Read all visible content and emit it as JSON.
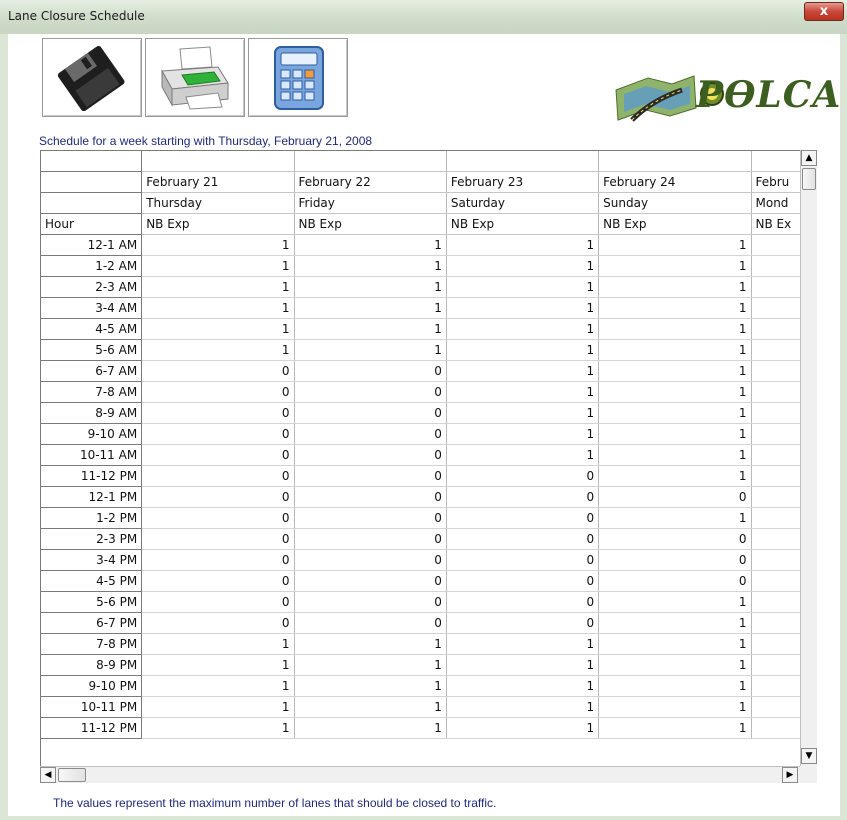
{
  "window": {
    "title": "Lane Closure Schedule",
    "close_glyph": "x"
  },
  "toolbar": [
    {
      "name": "save-button",
      "icon": "floppy-disk-icon"
    },
    {
      "name": "print-button",
      "icon": "printer-icon"
    },
    {
      "name": "calculator-button",
      "icon": "calculator-icon"
    }
  ],
  "logo": {
    "text": "PƟLCA"
  },
  "schedule": {
    "caption": "Schedule for a week starting with Thursday, February 21, 2008",
    "hour_header": "Hour",
    "columns": [
      {
        "date": "February 21",
        "day": "Thursday",
        "direction": "NB Exp"
      },
      {
        "date": "February 22",
        "day": "Friday",
        "direction": "NB Exp"
      },
      {
        "date": "February 23",
        "day": "Saturday",
        "direction": "NB Exp"
      },
      {
        "date": "February 24",
        "day": "Sunday",
        "direction": "NB Exp"
      },
      {
        "date": "Febru",
        "day": "Mond",
        "direction": "NB Ex"
      }
    ],
    "rows": [
      {
        "hour": "12-1 AM",
        "values": [
          "1",
          "1",
          "1",
          "1",
          ""
        ]
      },
      {
        "hour": "1-2 AM",
        "values": [
          "1",
          "1",
          "1",
          "1",
          ""
        ]
      },
      {
        "hour": "2-3 AM",
        "values": [
          "1",
          "1",
          "1",
          "1",
          ""
        ]
      },
      {
        "hour": "3-4 AM",
        "values": [
          "1",
          "1",
          "1",
          "1",
          ""
        ]
      },
      {
        "hour": "4-5 AM",
        "values": [
          "1",
          "1",
          "1",
          "1",
          ""
        ]
      },
      {
        "hour": "5-6 AM",
        "values": [
          "1",
          "1",
          "1",
          "1",
          ""
        ]
      },
      {
        "hour": "6-7 AM",
        "values": [
          "0",
          "0",
          "1",
          "1",
          ""
        ]
      },
      {
        "hour": "7-8 AM",
        "values": [
          "0",
          "0",
          "1",
          "1",
          ""
        ]
      },
      {
        "hour": "8-9 AM",
        "values": [
          "0",
          "0",
          "1",
          "1",
          ""
        ]
      },
      {
        "hour": "9-10 AM",
        "values": [
          "0",
          "0",
          "1",
          "1",
          ""
        ]
      },
      {
        "hour": "10-11 AM",
        "values": [
          "0",
          "0",
          "1",
          "1",
          ""
        ]
      },
      {
        "hour": "11-12 PM",
        "values": [
          "0",
          "0",
          "0",
          "1",
          ""
        ]
      },
      {
        "hour": "12-1 PM",
        "values": [
          "0",
          "0",
          "0",
          "0",
          ""
        ]
      },
      {
        "hour": "1-2 PM",
        "values": [
          "0",
          "0",
          "0",
          "1",
          ""
        ]
      },
      {
        "hour": "2-3 PM",
        "values": [
          "0",
          "0",
          "0",
          "0",
          ""
        ]
      },
      {
        "hour": "3-4 PM",
        "values": [
          "0",
          "0",
          "0",
          "0",
          ""
        ]
      },
      {
        "hour": "4-5 PM",
        "values": [
          "0",
          "0",
          "0",
          "0",
          ""
        ]
      },
      {
        "hour": "5-6 PM",
        "values": [
          "0",
          "0",
          "0",
          "1",
          ""
        ]
      },
      {
        "hour": "6-7 PM",
        "values": [
          "0",
          "0",
          "0",
          "1",
          ""
        ]
      },
      {
        "hour": "7-8 PM",
        "values": [
          "1",
          "1",
          "1",
          "1",
          ""
        ]
      },
      {
        "hour": "8-9 PM",
        "values": [
          "1",
          "1",
          "1",
          "1",
          ""
        ]
      },
      {
        "hour": "9-10 PM",
        "values": [
          "1",
          "1",
          "1",
          "1",
          ""
        ]
      },
      {
        "hour": "10-11 PM",
        "values": [
          "1",
          "1",
          "1",
          "1",
          ""
        ]
      },
      {
        "hour": "11-12 PM",
        "values": [
          "1",
          "1",
          "1",
          "1",
          ""
        ]
      }
    ],
    "scroll_up": "▲",
    "scroll_down": "▼",
    "scroll_left": "◀",
    "scroll_right": "▶"
  },
  "footer": {
    "note": "The values represent the maximum number of lanes that should be closed to traffic."
  }
}
